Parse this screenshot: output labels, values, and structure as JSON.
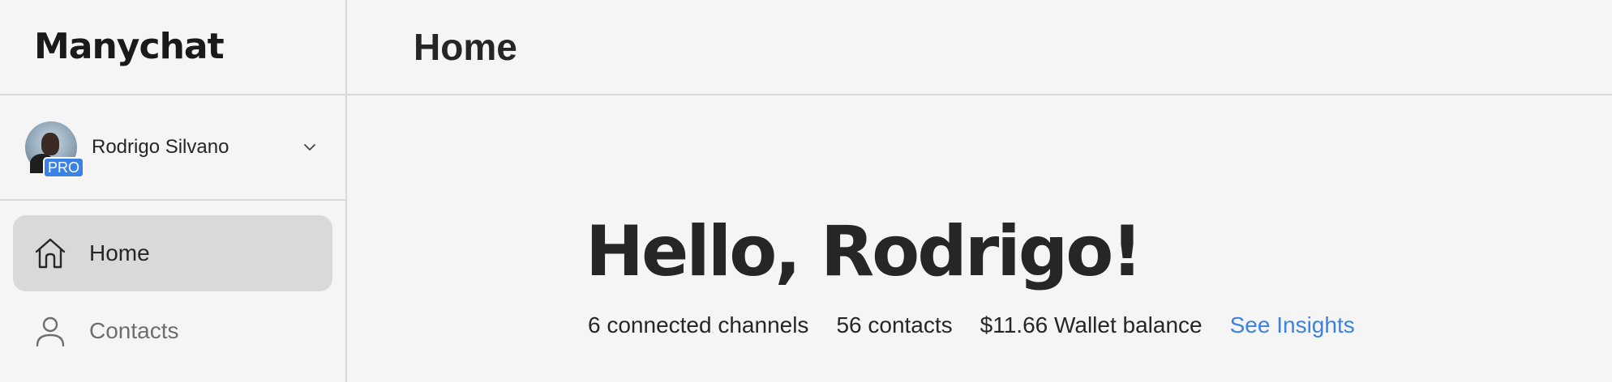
{
  "app": {
    "logo_text": "Manychat"
  },
  "account": {
    "name": "Rodrigo Silvano",
    "badge": "PRO"
  },
  "nav": {
    "items": [
      {
        "label": "Home",
        "icon": "home-icon",
        "active": true
      },
      {
        "label": "Contacts",
        "icon": "user-icon",
        "active": false
      }
    ]
  },
  "header": {
    "title": "Home"
  },
  "main": {
    "greeting": "Hello, Rodrigo!",
    "stats": [
      {
        "value": "6",
        "label": "connected channels"
      },
      {
        "value": "56",
        "label": "contacts"
      },
      {
        "value": "$11.66",
        "label": "Wallet balance"
      }
    ],
    "insights_link": "See Insights"
  },
  "colors": {
    "accent": "#3b82e6",
    "text": "#262626",
    "background": "#f5f5f5",
    "active_nav": "#d9d9d9"
  }
}
